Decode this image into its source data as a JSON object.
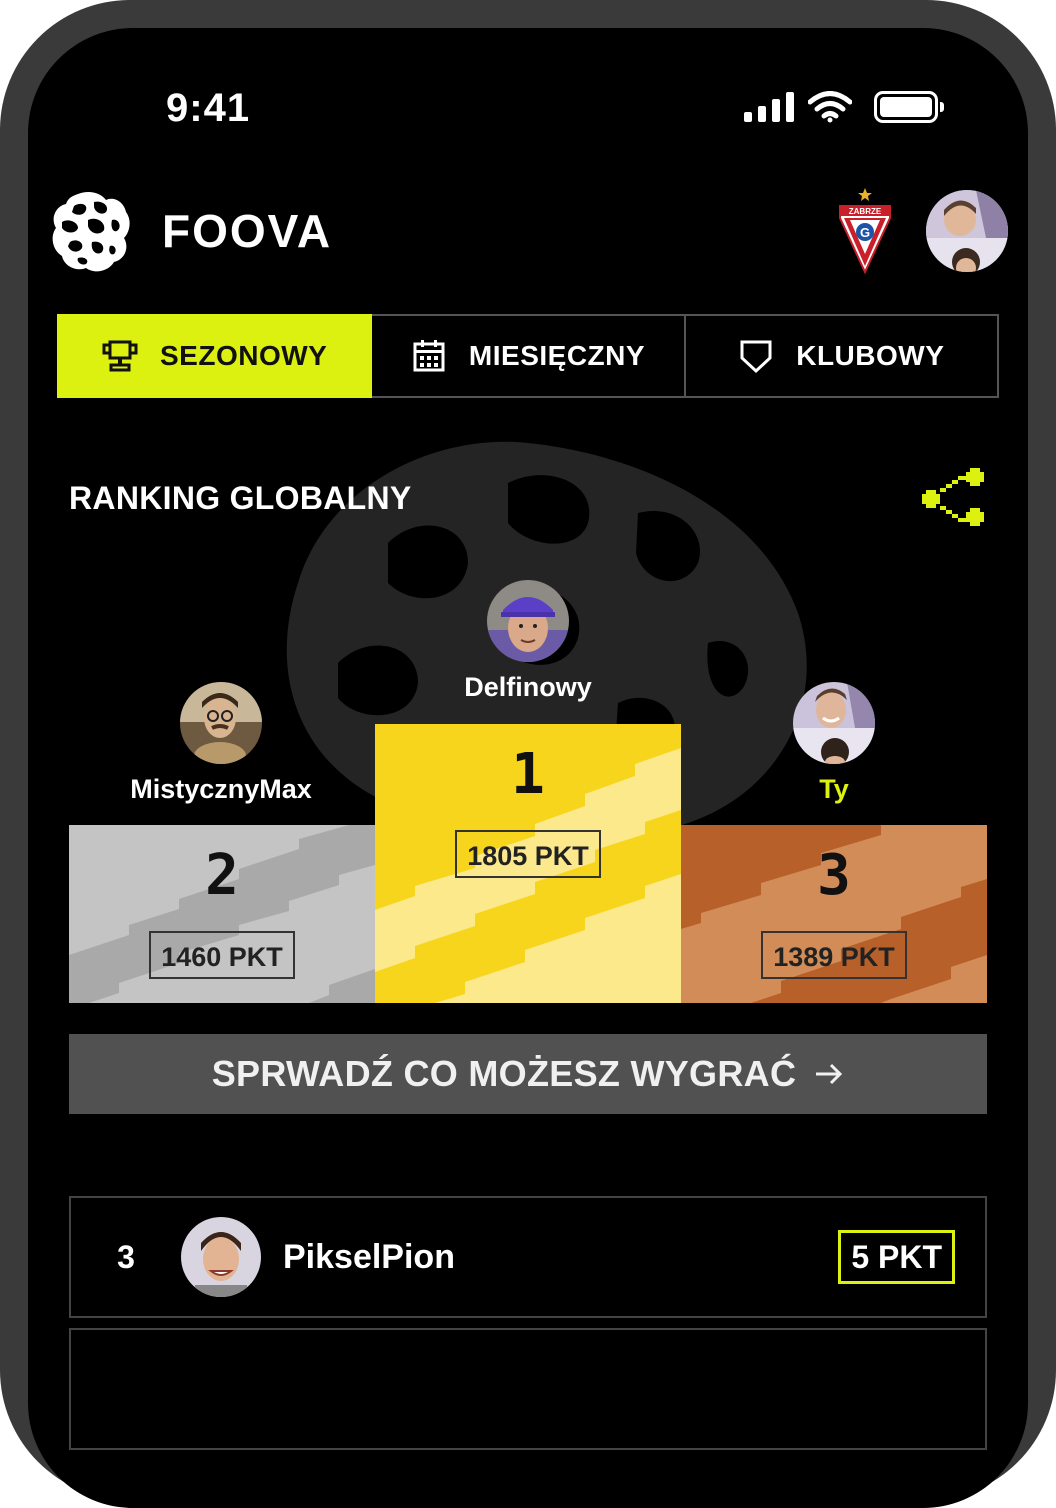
{
  "status_bar": {
    "time": "9:41"
  },
  "header": {
    "brand": "FOOVA",
    "club_badge_text": "ZABRZE"
  },
  "tabs": [
    {
      "label": "SEZONOWY",
      "icon": "trophy-icon",
      "active": true
    },
    {
      "label": "MIESIĘCZNY",
      "icon": "calendar-icon",
      "active": false
    },
    {
      "label": "KLUBOWY",
      "icon": "shield-icon",
      "active": false
    }
  ],
  "ranking": {
    "title": "RANKING GLOBALNY",
    "first": {
      "name": "Delfinowy",
      "rank": "1",
      "points": "1805 PKT"
    },
    "second": {
      "name": "MistycznyMax",
      "rank": "2",
      "points": "1460 PKT"
    },
    "third": {
      "name": "Ty",
      "rank": "3",
      "points": "1389 PKT"
    }
  },
  "cta": {
    "label": "SPRWADŹ CO MOŻESZ WYGRAĆ",
    "icon": "arrow-right-icon"
  },
  "list": [
    {
      "rank": "3",
      "name": "PikselPion",
      "points": "5 PKT"
    }
  ],
  "colors": {
    "accent": "#dcf10f",
    "gold": "#f7d51d",
    "silver": "#b8b8b8",
    "bronze": "#c8804c",
    "cta_bg": "#515151"
  }
}
